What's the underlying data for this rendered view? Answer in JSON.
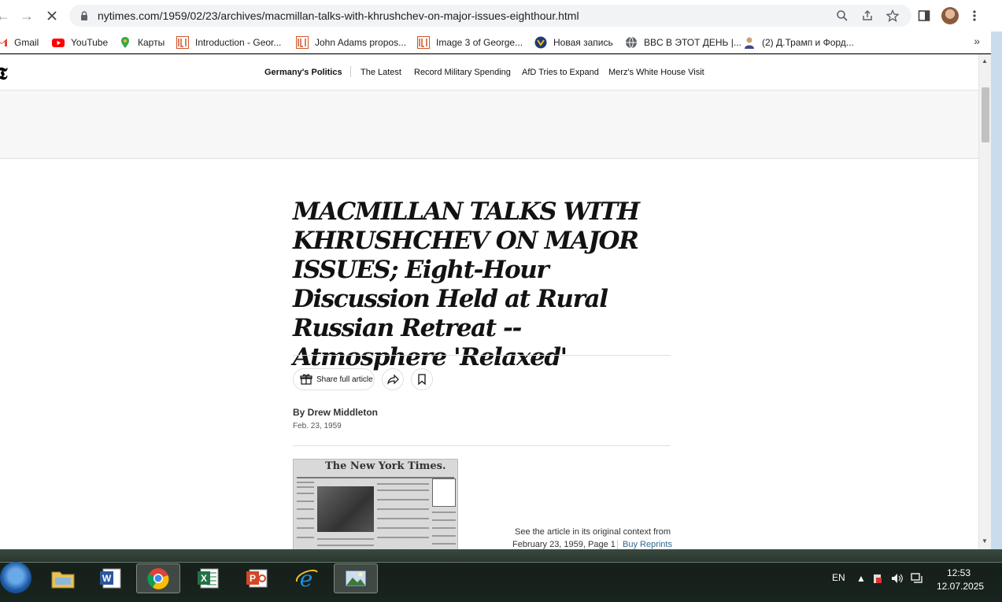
{
  "browser": {
    "url": "nytimes.com/1959/02/23/archives/macmillan-talks-with-khrushchev-on-major-issues-eighthour.html",
    "bookmarks": [
      {
        "label": "Gmail",
        "icon": "gmail-icon"
      },
      {
        "label": "YouTube",
        "icon": "youtube-icon"
      },
      {
        "label": "Карты",
        "icon": "maps-icon"
      },
      {
        "label": "Introduction - Geor...",
        "icon": "loc-icon"
      },
      {
        "label": "John Adams propos...",
        "icon": "loc-icon"
      },
      {
        "label": "Image 3 of George...",
        "icon": "loc-icon"
      },
      {
        "label": "Новая запись",
        "icon": "blog-icon"
      },
      {
        "label": "BBC В ЭТОТ ДЕНЬ |...",
        "icon": "globe-icon"
      },
      {
        "label": "(2) Д.Трамп и Форд...",
        "icon": "person-icon"
      }
    ],
    "more_bookmarks": "»"
  },
  "nyt": {
    "logo": "𝕿",
    "nav": {
      "section": "Germany's Politics",
      "items": [
        "The Latest",
        "Record Military Spending",
        "AfD Tries to Expand",
        "Merz's White House Visit"
      ]
    }
  },
  "article": {
    "headline": "MACMILLAN TALKS WITH KHRUSHCHEV ON MAJOR ISSUES; Eight-Hour Discussion Held at Rural Russian Retreat -- Atmosphere 'Relaxed'",
    "share_label": "Share full article",
    "byline": "By Drew Middleton",
    "date": "Feb. 23, 1959",
    "front_page_masthead": "The New York Times.",
    "context_line1": "See the article in its original context from",
    "context_line2": "February 23, 1959, Page 1",
    "buy_reprints": "Buy Reprints"
  },
  "taskbar": {
    "apps": [
      {
        "name": "explorer-app",
        "icon": "folder-icon"
      },
      {
        "name": "word-app",
        "icon": "word-icon"
      },
      {
        "name": "chrome-app",
        "icon": "chrome-icon",
        "active": true
      },
      {
        "name": "excel-app",
        "icon": "excel-icon"
      },
      {
        "name": "powerpoint-app",
        "icon": "powerpoint-icon"
      },
      {
        "name": "ie-app",
        "icon": "ie-icon"
      },
      {
        "name": "image-viewer-app",
        "icon": "picture-icon"
      }
    ],
    "language": "EN",
    "time": "12:53",
    "date": "12.07.2025"
  },
  "colors": {
    "link": "#326891",
    "chrome_bg": "#ffffff",
    "omnibox_bg": "#f1f3f4"
  }
}
